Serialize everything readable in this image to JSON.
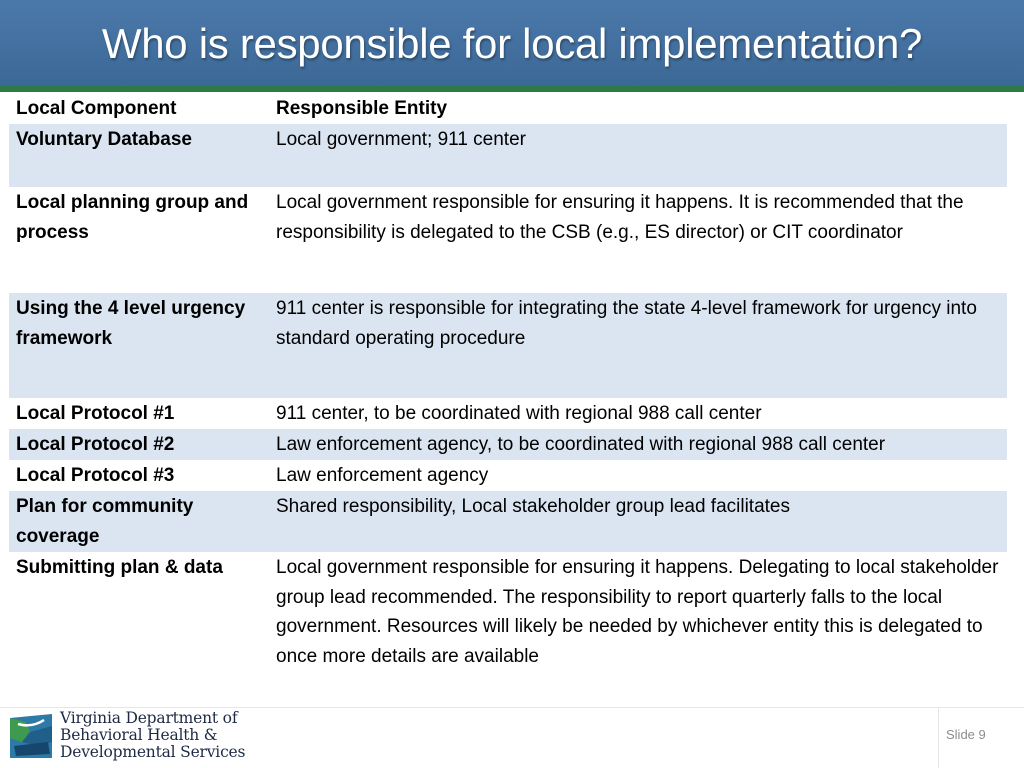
{
  "slide": {
    "title": "Who is responsible for local implementation?",
    "slide_number": "Slide 9"
  },
  "table": {
    "headers": [
      "Local Component",
      "Responsible Entity"
    ],
    "rows": [
      {
        "component": "Voluntary Database",
        "entity": "Local government; 911 center"
      },
      {
        "component": "Local planning group and process",
        "entity": "Local government responsible for ensuring it happens. It is recommended that the responsibility is delegated to the CSB (e.g., ES director) or CIT coordinator"
      },
      {
        "component": "Using the 4 level urgency framework",
        "entity": "911 center is responsible for integrating the state 4-level framework for urgency into standard operating procedure"
      },
      {
        "component": "Local Protocol #1",
        "entity": "911 center, to be coordinated with regional 988 call center"
      },
      {
        "component": "Local Protocol #2",
        "entity": "Law enforcement agency, to be coordinated with regional 988 call center"
      },
      {
        "component": "Local Protocol #3",
        "entity": "Law enforcement agency"
      },
      {
        "component": "Plan for community coverage",
        "entity": "Shared responsibility, Local stakeholder group lead facilitates"
      },
      {
        "component": "Submitting plan & data",
        "entity": "Local government responsible for ensuring it happens. Delegating to local stakeholder group lead recommended. The responsibility to report quarterly falls to the local government. Resources will likely be needed by whichever entity this is delegated to once more details are available"
      }
    ]
  },
  "footer": {
    "org_line_1": "Virginia Department of",
    "org_line_2": "Behavioral Health &",
    "org_line_3": "Developmental Services",
    "logo_icon": "virginia-state-logo-icon"
  },
  "colors": {
    "title_bar": "#4471a2",
    "accent_rule": "#2d7a45",
    "row_shade": "#dbe5f1"
  }
}
